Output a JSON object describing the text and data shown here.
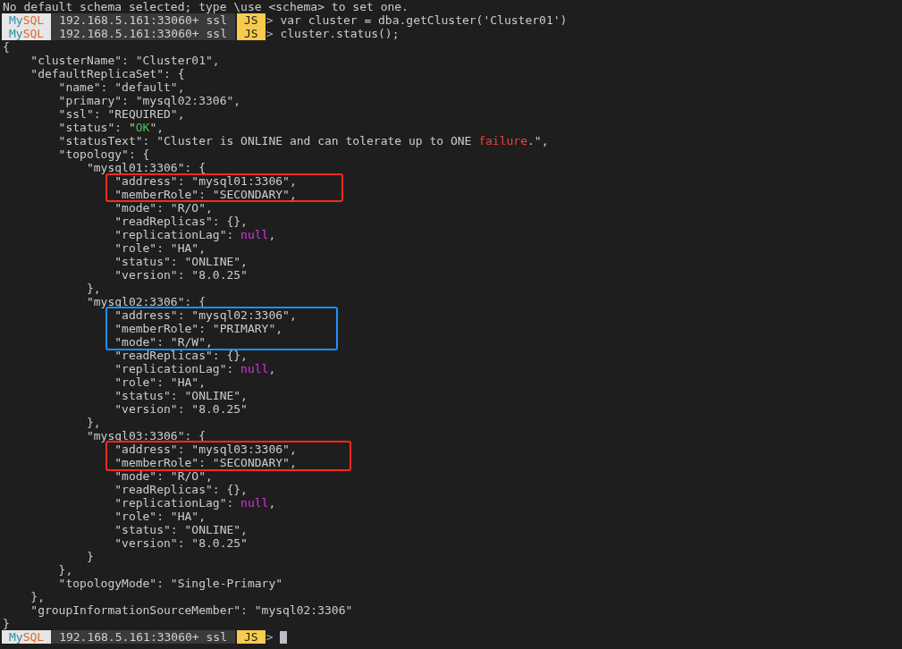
{
  "lines": [
    {
      "kind": "text",
      "text": "No default schema selected; type \\use <schema> to set one."
    },
    {
      "kind": "prompt",
      "mode_parts": [
        "My",
        "SQL"
      ],
      "host": "192.168.5.161:33060+ ssl",
      "language": "JS",
      "arrow": ">",
      "command": "var cluster = dba.getCluster('Cluster01')",
      "cursor": false
    },
    {
      "kind": "prompt",
      "mode_parts": [
        "My",
        "SQL"
      ],
      "host": "192.168.5.161:33060+ ssl",
      "language": "JS",
      "arrow": ">",
      "command": "cluster.status();",
      "cursor": false
    },
    {
      "kind": "text",
      "text": "{"
    },
    {
      "kind": "text",
      "text": "    \"clusterName\": \"Cluster01\","
    },
    {
      "kind": "text",
      "text": "    \"defaultReplicaSet\": {"
    },
    {
      "kind": "text",
      "text": "        \"name\": \"default\","
    },
    {
      "kind": "text",
      "text": "        \"primary\": \"mysql02:3306\","
    },
    {
      "kind": "text",
      "text": "        \"ssl\": \"REQUIRED\","
    },
    {
      "kind": "segments",
      "segments": [
        {
          "kind": "plain",
          "text": "        \"status\": \""
        },
        {
          "kind": "ok",
          "text": "OK"
        },
        {
          "kind": "plain",
          "text": "\","
        }
      ]
    },
    {
      "kind": "segments",
      "segments": [
        {
          "kind": "plain",
          "text": "        \"statusText\": \"Cluster is ONLINE and can tolerate up to ONE "
        },
        {
          "kind": "error",
          "text": "failure"
        },
        {
          "kind": "plain",
          "text": ".\","
        }
      ]
    },
    {
      "kind": "text",
      "text": "        \"topology\": {"
    },
    {
      "kind": "text",
      "text": "            \"mysql01:3306\": {"
    },
    {
      "kind": "text",
      "text": "                \"address\": \"mysql01:3306\","
    },
    {
      "kind": "text",
      "text": "                \"memberRole\": \"SECONDARY\","
    },
    {
      "kind": "text",
      "text": "                \"mode\": \"R/O\","
    },
    {
      "kind": "text",
      "text": "                \"readReplicas\": {},"
    },
    {
      "kind": "segments",
      "segments": [
        {
          "kind": "plain",
          "text": "                \"replicationLag\": "
        },
        {
          "kind": "null",
          "text": "null"
        },
        {
          "kind": "plain",
          "text": ","
        }
      ]
    },
    {
      "kind": "text",
      "text": "                \"role\": \"HA\","
    },
    {
      "kind": "text",
      "text": "                \"status\": \"ONLINE\","
    },
    {
      "kind": "text",
      "text": "                \"version\": \"8.0.25\""
    },
    {
      "kind": "text",
      "text": "            },"
    },
    {
      "kind": "text",
      "text": "            \"mysql02:3306\": {"
    },
    {
      "kind": "text",
      "text": "                \"address\": \"mysql02:3306\","
    },
    {
      "kind": "text",
      "text": "                \"memberRole\": \"PRIMARY\","
    },
    {
      "kind": "text",
      "text": "                \"mode\": \"R/W\","
    },
    {
      "kind": "text",
      "text": "                \"readReplicas\": {},"
    },
    {
      "kind": "segments",
      "segments": [
        {
          "kind": "plain",
          "text": "                \"replicationLag\": "
        },
        {
          "kind": "null",
          "text": "null"
        },
        {
          "kind": "plain",
          "text": ","
        }
      ]
    },
    {
      "kind": "text",
      "text": "                \"role\": \"HA\","
    },
    {
      "kind": "text",
      "text": "                \"status\": \"ONLINE\","
    },
    {
      "kind": "text",
      "text": "                \"version\": \"8.0.25\""
    },
    {
      "kind": "text",
      "text": "            },"
    },
    {
      "kind": "text",
      "text": "            \"mysql03:3306\": {"
    },
    {
      "kind": "text",
      "text": "                \"address\": \"mysql03:3306\","
    },
    {
      "kind": "text",
      "text": "                \"memberRole\": \"SECONDARY\","
    },
    {
      "kind": "text",
      "text": "                \"mode\": \"R/O\","
    },
    {
      "kind": "text",
      "text": "                \"readReplicas\": {},"
    },
    {
      "kind": "segments",
      "segments": [
        {
          "kind": "plain",
          "text": "                \"replicationLag\": "
        },
        {
          "kind": "null",
          "text": "null"
        },
        {
          "kind": "plain",
          "text": ","
        }
      ]
    },
    {
      "kind": "text",
      "text": "                \"role\": \"HA\","
    },
    {
      "kind": "text",
      "text": "                \"status\": \"ONLINE\","
    },
    {
      "kind": "text",
      "text": "                \"version\": \"8.0.25\""
    },
    {
      "kind": "text",
      "text": "            }"
    },
    {
      "kind": "text",
      "text": "        },"
    },
    {
      "kind": "text",
      "text": "        \"topologyMode\": \"Single-Primary\""
    },
    {
      "kind": "text",
      "text": "    },"
    },
    {
      "kind": "text",
      "text": "    \"groupInformationSourceMember\": \"mysql02:3306\""
    },
    {
      "kind": "text",
      "text": "}"
    },
    {
      "kind": "prompt",
      "mode_parts": [
        "My",
        "SQL"
      ],
      "host": "192.168.5.161:33060+ ssl",
      "language": "JS",
      "arrow": ">",
      "cursor": true
    }
  ],
  "highlights": [
    {
      "color": "#ff2a1f"
    },
    {
      "color": "#1e90ff"
    },
    {
      "color": "#ff2a1f"
    }
  ]
}
